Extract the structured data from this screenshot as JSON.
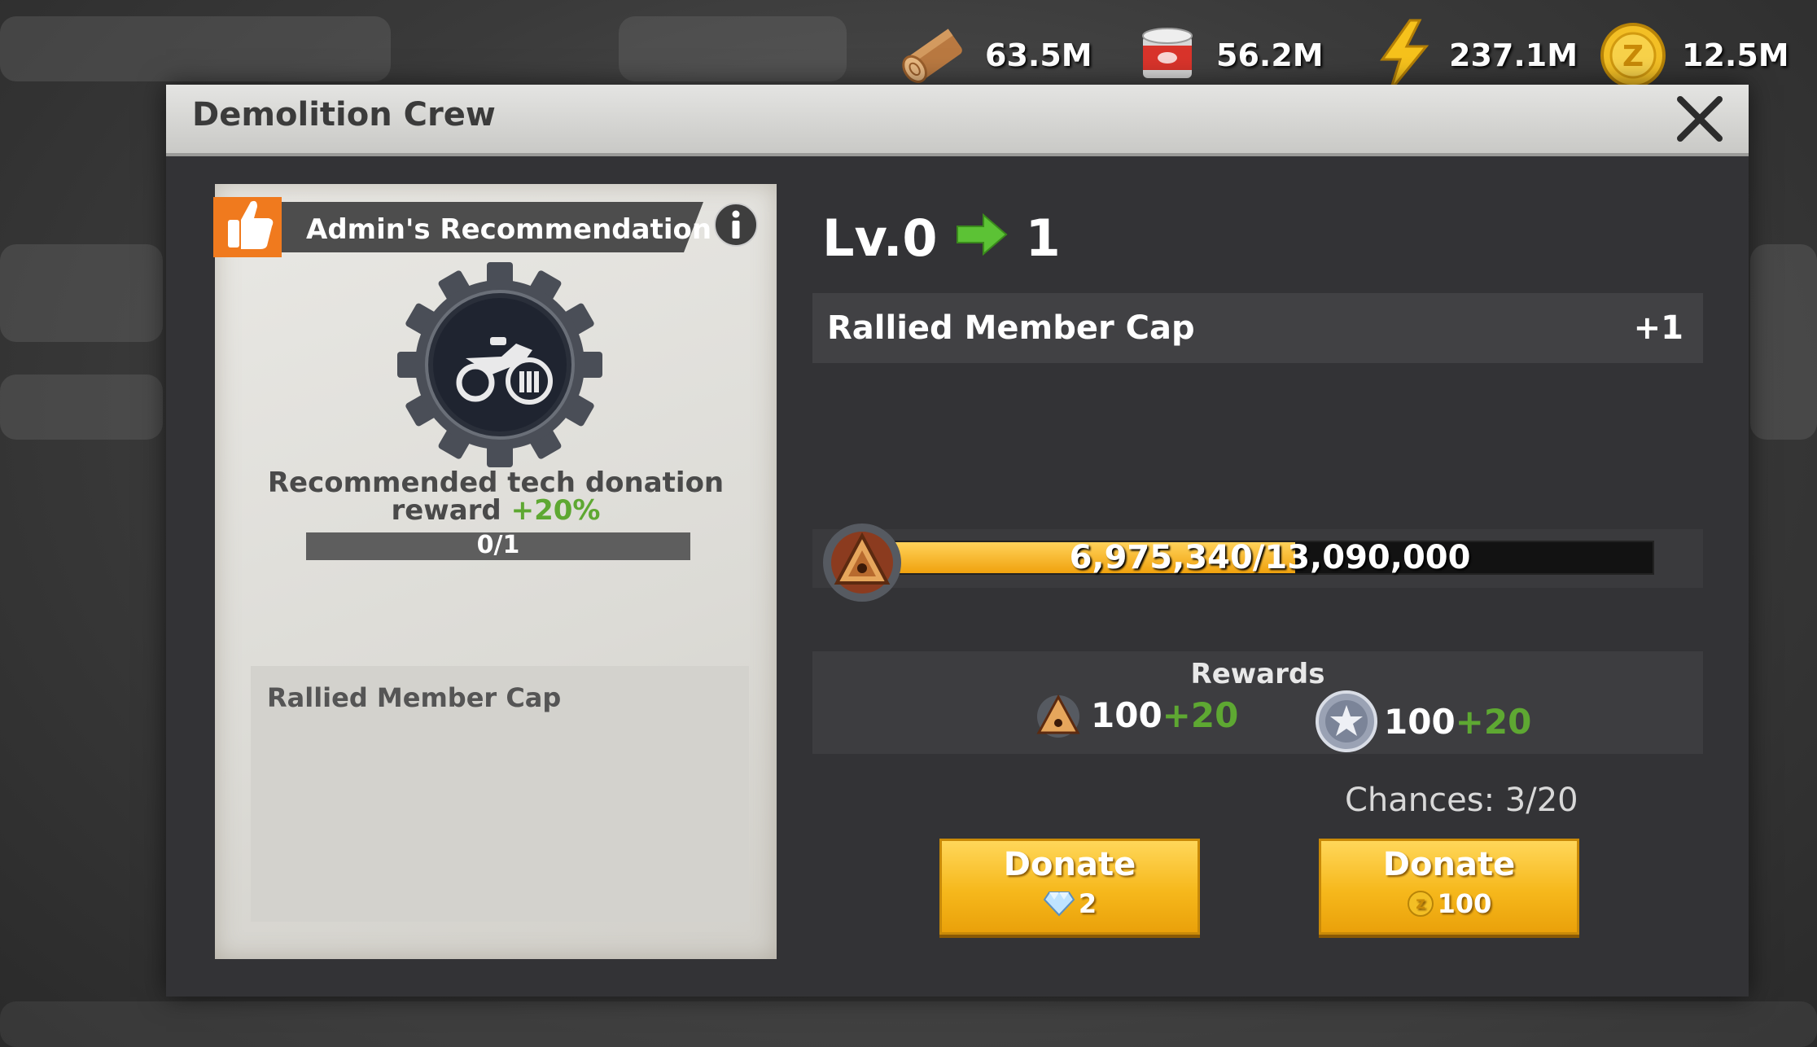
{
  "resources": [
    {
      "name": "wood",
      "icon": "wood-log-icon",
      "value": "63.5M"
    },
    {
      "name": "food",
      "icon": "food-can-icon",
      "value": "56.2M"
    },
    {
      "name": "energy",
      "icon": "lightning-icon",
      "value": "237.1M"
    },
    {
      "name": "coins",
      "icon": "gold-coin-icon",
      "value": "12.5M"
    }
  ],
  "window": {
    "title": "Demolition Crew"
  },
  "recommendation": {
    "banner": "Admin's Recommendation",
    "desc_line1": "Recommended tech donation",
    "desc_line2": "reward",
    "bonus": "+20%",
    "progress_text": "0/1",
    "effect_label": "Rallied Member Cap"
  },
  "level": {
    "from": "Lv.0",
    "to": "1"
  },
  "effect": {
    "name": "Rallied Member Cap",
    "amount": "+1"
  },
  "progress": {
    "text": "6,975,340/13,090,000",
    "current": 6975340,
    "max": 13090000
  },
  "rewards": {
    "header": "Rewards",
    "items": [
      {
        "icon": "tech-badge-icon",
        "base": "100",
        "bonus": "+20"
      },
      {
        "icon": "silver-star-medal-icon",
        "base": "100",
        "bonus": "+20"
      }
    ]
  },
  "chances": "Chances: 3/20",
  "buttons": {
    "donate_gems": {
      "label": "Donate",
      "cost": "2",
      "icon": "diamond-icon"
    },
    "donate_coins": {
      "label": "Donate",
      "cost": "100",
      "icon": "gold-coin-icon"
    }
  },
  "colors": {
    "accent_orange": "#f0a20e",
    "bonus_green": "#5ea832",
    "panel": "#333336"
  }
}
